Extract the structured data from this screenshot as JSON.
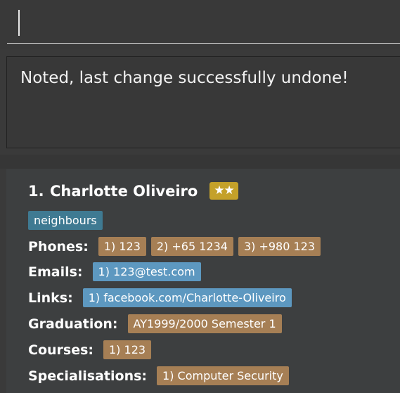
{
  "command_box": {
    "value": ""
  },
  "result": {
    "message": "Noted, last change successfully undone!"
  },
  "person": {
    "index": "1.",
    "name": "Charlotte Oliveiro",
    "rating": "★★",
    "tags": [
      "neighbours"
    ],
    "phones_label": "Phones:",
    "phones": [
      "1) 123",
      "2) +65 1234",
      "3) +980 123"
    ],
    "emails_label": "Emails:",
    "emails": [
      "1) 123@test.com"
    ],
    "links_label": "Links:",
    "links": [
      "1) facebook.com/Charlotte-Oliveiro"
    ],
    "graduation_label": "Graduation:",
    "graduation": "AY1999/2000 Semester 1",
    "courses_label": "Courses:",
    "courses": [
      "1) 123"
    ],
    "specialisations_label": "Specialisations:",
    "specialisations": [
      "1) Computer Security"
    ]
  },
  "colors": {
    "background": "#3a3a3a",
    "tag": "#3f7a92",
    "chip_tan": "#a67f55",
    "chip_blue": "#5d98c0",
    "stars": "#c4a12a"
  }
}
